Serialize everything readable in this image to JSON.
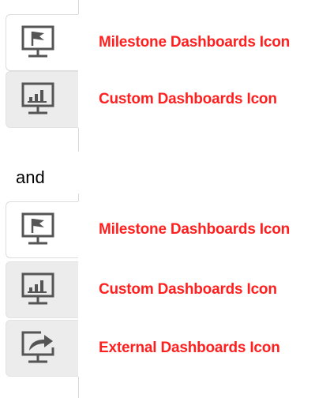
{
  "group1": {
    "items": [
      {
        "label": "Milestone Dashboards Icon",
        "icon": "monitor-flag-icon"
      },
      {
        "label": "Custom Dashboards Icon",
        "icon": "monitor-bar-chart-icon"
      }
    ]
  },
  "separator": "and",
  "group2": {
    "items": [
      {
        "label": "Milestone Dashboards Icon",
        "icon": "monitor-flag-icon"
      },
      {
        "label": "Custom Dashboards Icon",
        "icon": "monitor-bar-chart-icon"
      },
      {
        "label": "External Dashboards Icon",
        "icon": "monitor-share-arrow-icon"
      }
    ]
  },
  "colors": {
    "label": "#ff1f1f",
    "icon": "#555555",
    "tile_gray": "#ececec"
  }
}
